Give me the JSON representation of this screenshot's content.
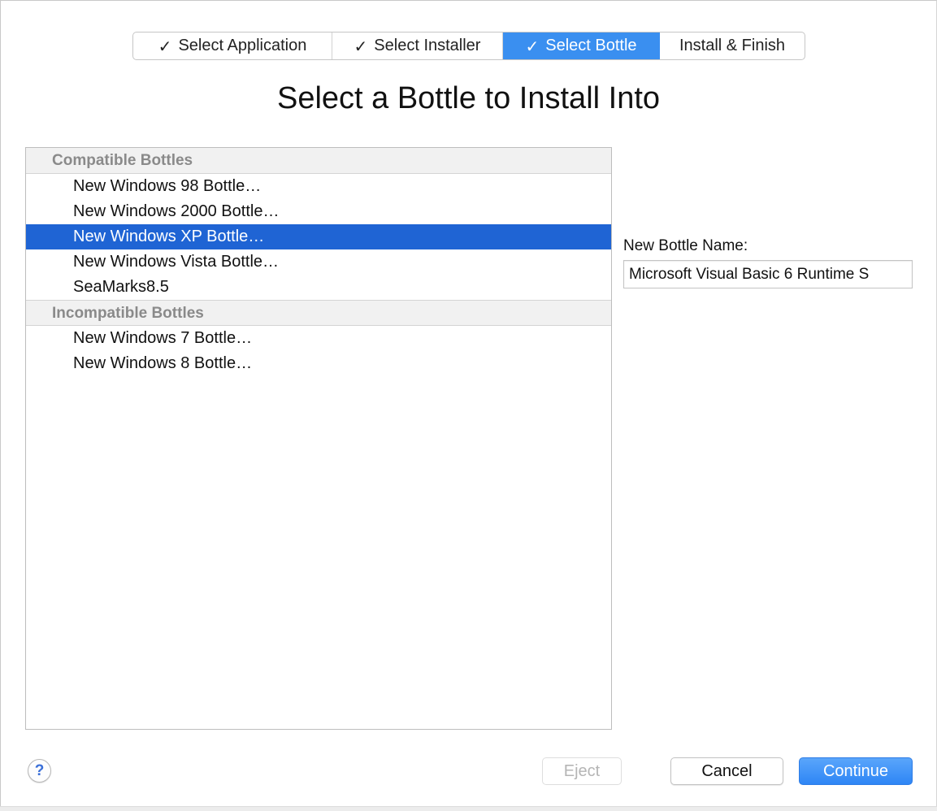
{
  "steps": [
    {
      "label": "Select Application",
      "checked": true,
      "active": false
    },
    {
      "label": "Select Installer",
      "checked": true,
      "active": false
    },
    {
      "label": "Select Bottle",
      "checked": true,
      "active": true
    },
    {
      "label": "Install & Finish",
      "checked": false,
      "active": false
    }
  ],
  "check_glyph": "✓",
  "title": "Select a Bottle to Install Into",
  "bottles": {
    "compatible_header": "Compatible Bottles",
    "compatible": [
      "New Windows 98 Bottle…",
      "New Windows 2000 Bottle…",
      "New Windows XP Bottle…",
      "New Windows Vista Bottle…",
      "SeaMarks8.5"
    ],
    "selected": "New Windows XP Bottle…",
    "incompatible_header": "Incompatible Bottles",
    "incompatible": [
      "New Windows 7 Bottle…",
      "New Windows 8 Bottle…"
    ]
  },
  "new_bottle": {
    "label": "New Bottle Name:",
    "value": "Microsoft Visual Basic 6 Runtime S"
  },
  "buttons": {
    "help": "?",
    "eject": "Eject",
    "cancel": "Cancel",
    "continue": "Continue"
  },
  "colors": {
    "accent": "#3a8ff0",
    "selection": "#1f64d4"
  }
}
